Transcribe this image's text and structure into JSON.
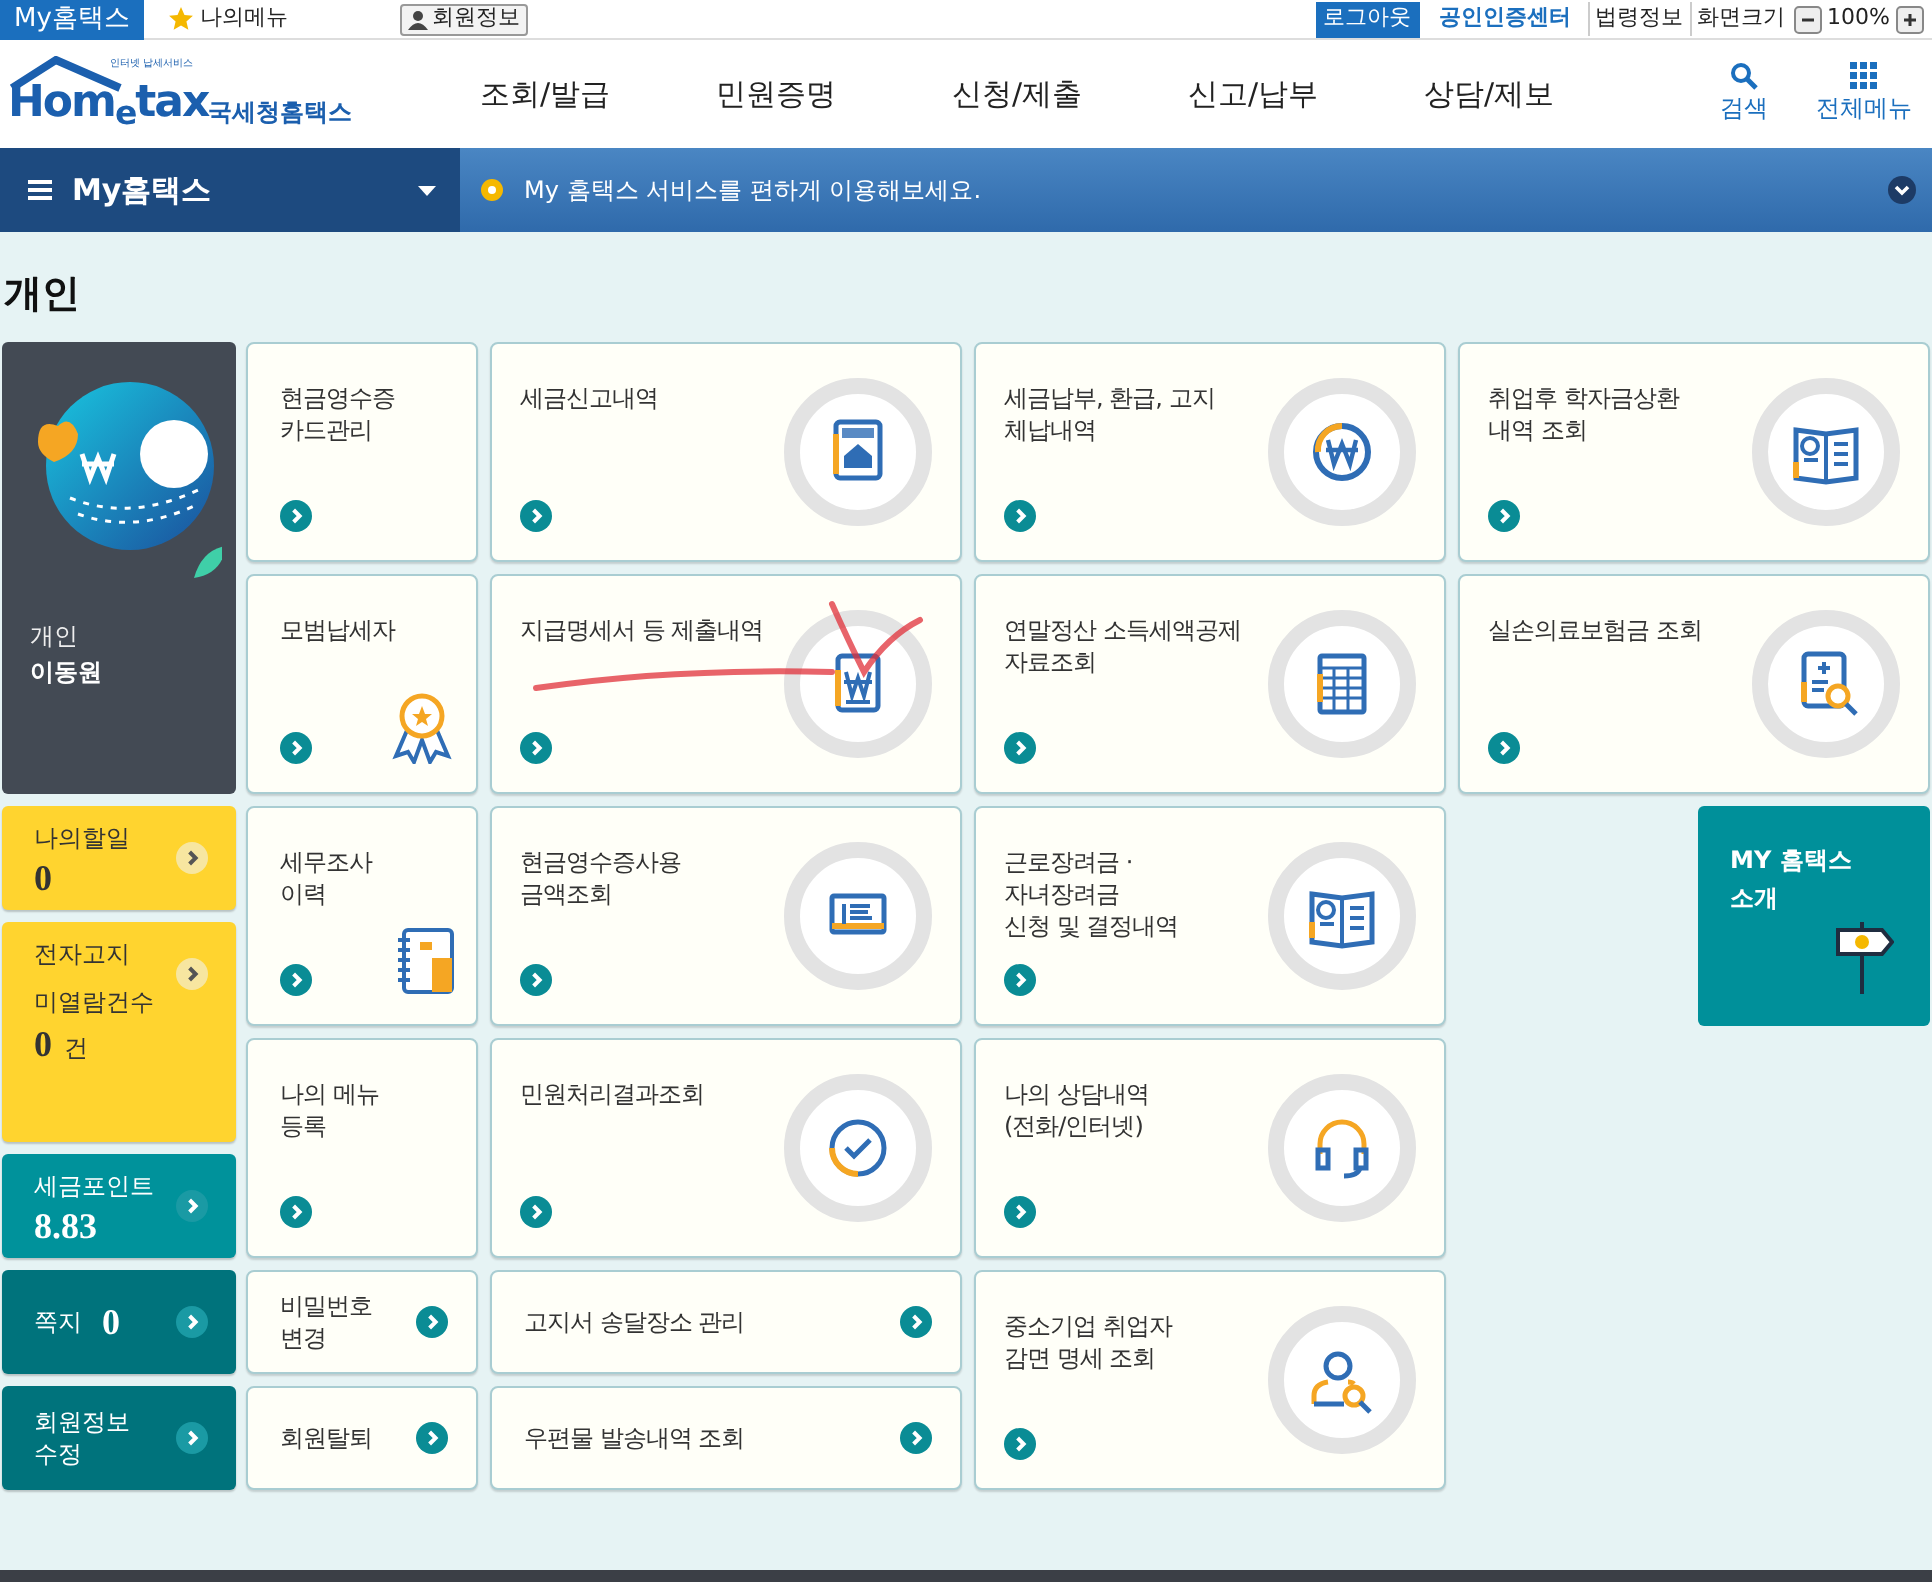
{
  "top_bar": {
    "brand": "My홈택스",
    "links": [
      {
        "label": "나의메뉴",
        "kind": "star"
      },
      {
        "label": "회원정보",
        "kind": "person"
      }
    ],
    "logout": "로그아웃",
    "cert": "공인인증센터",
    "links_right": [
      "법령정보",
      "화면크기"
    ],
    "zoom": "100%"
  },
  "header": {
    "tagline": "인터넷 납세서비스",
    "logo": "Hom$_{e}$tax",
    "site": "국세청홈택스",
    "nav": [
      "조회/발급",
      "민원증명",
      "신청/제출",
      "신고/납부",
      "상담/제보"
    ],
    "tools": [
      {
        "label": "검색",
        "kind": "search"
      },
      {
        "label": "전체메뉴",
        "kind": "grid"
      }
    ]
  },
  "my_bar": {
    "title": "My홈택스",
    "message": "My 홈택스 서비스를 편하게 이용해보세요."
  },
  "section_title": "개인",
  "profile": {
    "label": "개인",
    "name": "이동원"
  },
  "side_panels": [
    {
      "kind": "notice",
      "color": "#ffd42f",
      "label": "나의할일",
      "value": "0"
    },
    {
      "kind": "notice",
      "color": "#ffd42f",
      "label": "전자고지",
      "sublabel": "미열람건수",
      "value": "0",
      "unit": "건"
    },
    {
      "kind": "account",
      "color": "#00929b",
      "label": "세금포인트",
      "value": "8.83"
    },
    {
      "kind": "account",
      "color": "#00737c",
      "label": "쪽지",
      "value": "0",
      "inline": true
    },
    {
      "kind": "account",
      "color": "#00737c",
      "label": "회원정보\n수정"
    }
  ],
  "cards": [
    {
      "kind": "plain",
      "title": "현금영수증\n카드관리"
    },
    {
      "kind": "tile",
      "title": "세금신고내역"
    },
    {
      "kind": "tile",
      "title": "세금납부, 환급, 고지\n체납내역"
    },
    {
      "kind": "tile",
      "title": "취업후 학자금상환\n내역 조회"
    },
    {
      "kind": "plain",
      "title": "모범납세자"
    },
    {
      "kind": "tile",
      "title": "지급명세서 등 제출내역"
    },
    {
      "kind": "tile",
      "title": "연말정산 소득세액공제\n자료조회"
    },
    {
      "kind": "tile",
      "title": "실손의료보험금 조회"
    },
    {
      "kind": "plain",
      "title": "세무조사\n이력"
    },
    {
      "kind": "tile",
      "title": "현금영수증사용\n금액조회"
    },
    {
      "kind": "tile",
      "title": "근로장려금 ·\n자녀장려금\n신청 및 결정내역"
    },
    {
      "kind": "promo",
      "title": "MY 홈택스\n소개"
    },
    {
      "kind": "plain",
      "title": "나의 메뉴\n등록"
    },
    {
      "kind": "tile",
      "title": "민원처리결과조회"
    },
    {
      "kind": "tile",
      "title": "나의 상담내역\n(전화/인터넷)"
    },
    {
      "kind": "link",
      "title": "비밀번호\n변경"
    },
    {
      "kind": "link",
      "title": "고지서 송달장소 관리"
    },
    {
      "kind": "tile",
      "title": "중소기업 취업자\n감면 명세 조회"
    },
    {
      "kind": "link",
      "title": "회원탈퇴"
    },
    {
      "kind": "link",
      "title": "우편물 발송내역 조회"
    }
  ]
}
